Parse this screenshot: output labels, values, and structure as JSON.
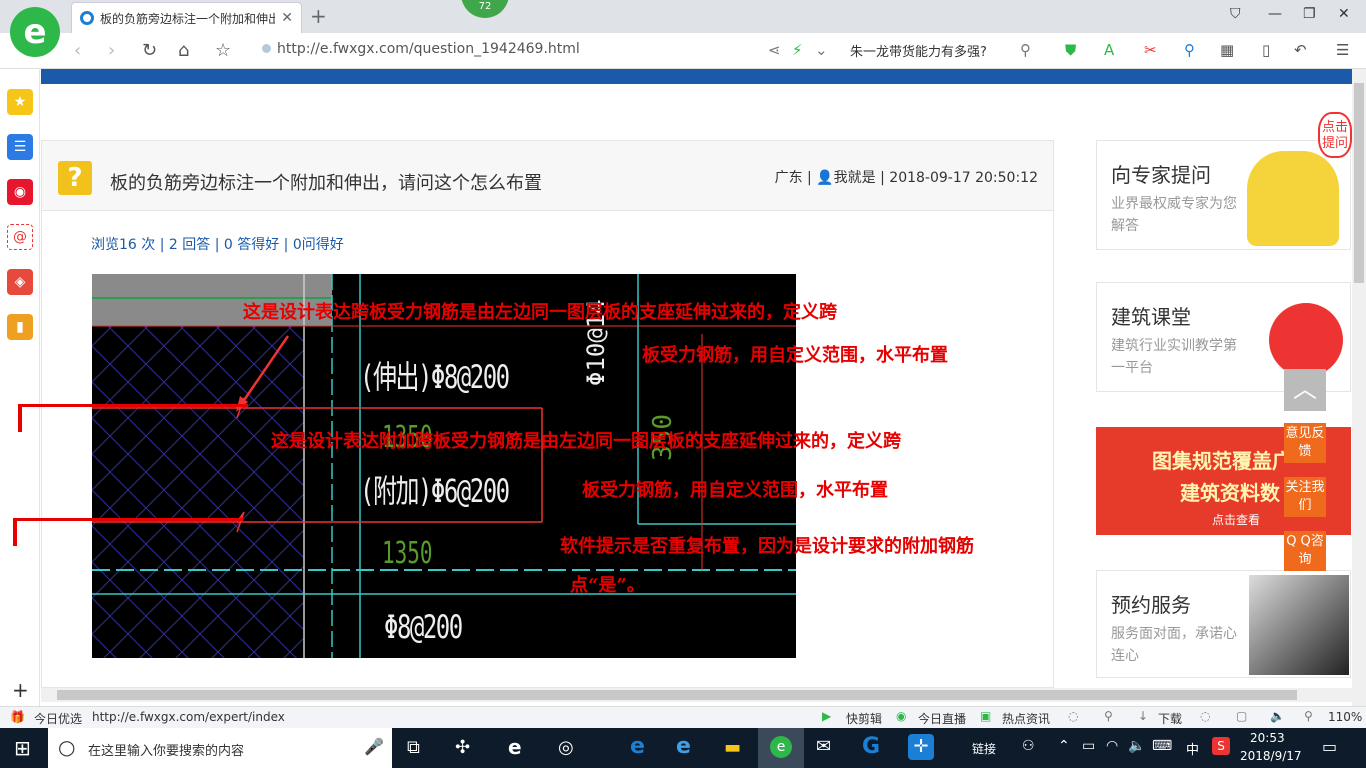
{
  "browser": {
    "tab_title": "板的负筋旁边标注一个附加和伸出，请问这个怎么布置",
    "badge": "72",
    "url": "http://e.fwxgx.com/question_1942469.html",
    "search_text": "朱一龙带货能力有多强?"
  },
  "question": {
    "title": "板的负筋旁边标注一个附加和伸出，请问这个怎么布置",
    "region": "广东",
    "user": "我就是",
    "datetime": "2018-09-17 20:50:12",
    "stats": "浏览16 次 | 2 回答 | 0 答得好 | 0问得好"
  },
  "cad": {
    "dim_top": "Φ10@14",
    "label_extend": "(伸出)Φ8@200",
    "dim1": "1350",
    "dim_vert": "350",
    "label_extra": "(附加)Φ6@200",
    "dim2": "1350",
    "label_bottom": "Φ8@200",
    "note1_line1": "这是设计表达跨板受力钢筋是由左边同一图层板的支座延伸过来的，定义跨",
    "note1_line2": "板受力钢筋，用自定义范围，水平布置",
    "note2_line1": "这是设计表达附加跨板受力钢筋是由左边同一图层板的支座延伸过来的，定义跨",
    "note2_line2": "板受力钢筋，用自定义范围，水平布置",
    "note3_line1": "软件提示是否重复布置，因为是设计要求的附加钢筋",
    "note3_line2": "点“是”。"
  },
  "sidebar_right": {
    "card1": {
      "title": "向专家提问",
      "desc": "业界最权威专家为您解答"
    },
    "card2": {
      "title": "建筑课堂",
      "desc": "建筑行业实训教学第一平台"
    },
    "banner": {
      "line1": "图集规范覆盖广",
      "line2": "建筑资料数",
      "cta": "点击查看"
    },
    "card3": {
      "title": "预约服务",
      "desc": "服务面对面，承诺心连心"
    },
    "corner_tag": "点击提问"
  },
  "floating": {
    "feedback": "意见反馈",
    "follow": "关注我们",
    "qq": "Q Q咨询"
  },
  "statusbar": {
    "left_label": "今日优选",
    "hover_url": "http://e.fwxgx.com/expert/index",
    "items": [
      "快剪辑",
      "今日直播",
      "热点资讯",
      "下载"
    ],
    "zoom": "110%"
  },
  "taskbar": {
    "search_placeholder": "在这里输入你要搜索的内容",
    "links": "链接",
    "ime": "中",
    "time": "20:53",
    "date": "2018/9/17"
  },
  "colors": {
    "accent": "#1a5aa8",
    "qicon": "#f1c21b",
    "float": "#f06a1e",
    "cad_red": "#e60000"
  }
}
